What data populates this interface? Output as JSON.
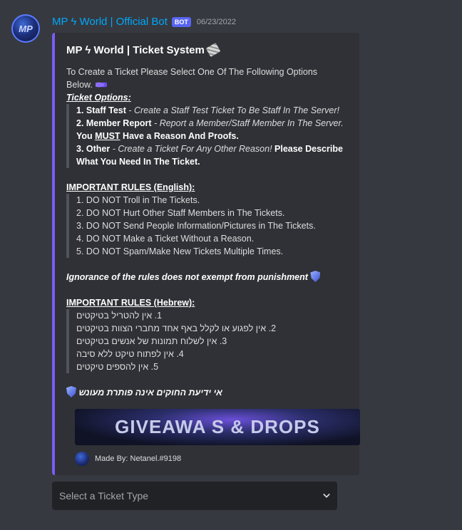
{
  "message": {
    "avatar_text": "MP",
    "username": "MP ϟ World | Official Bot",
    "badge": "BOT",
    "timestamp": "06/23/2022"
  },
  "embed": {
    "accent_color": "#7b5cf7",
    "title": "MP ϟ World | Ticket System",
    "title_icon": "ticket-icon",
    "intro_1": "To Create a Ticket Please Select One Of The Following Options",
    "intro_2": "Below.",
    "options_heading": "Ticket Options:",
    "opt1_label": "1. Staff Test",
    "opt1_desc": " - Create a Staff Test Ticket To Be Staff In The Server!",
    "opt2_label": "2. Member Report",
    "opt2_desc": " - Report a Member/Staff Member In The Server.",
    "opt2_extra_a": "You ",
    "opt2_extra_must": "MUST",
    "opt2_extra_b": " Have a Reason And Proofs.",
    "opt3_label": "3. Other",
    "opt3_desc": " - Create a Ticket For Any Other Reason!",
    "opt3_extra_a": " Please Describe",
    "opt3_extra_b": "What You Need In The Ticket.",
    "rules_en_heading": "IMPORTANT RULES (English):",
    "rules_en": [
      "1. DO NOT Troll in The Tickets.",
      "2. DO NOT Hurt Other Staff Members in The Tickets.",
      "3. DO NOT Send People Information/Pictures in The Tickets.",
      "4. DO NOT Make a Ticket Without a Reason.",
      "5. DO NOT Spam/Make New Tickets Multiple Times."
    ],
    "ignorance_en": "Ignorance of the rules does not exempt from punishment",
    "rules_he_heading": "IMPORTANT RULES (Hebrew):",
    "rules_he": [
      "1. אין להטריל בטיקטים",
      "2. אין לפגוע או לקלל באף אחד מחברי הצוות בטיקטים",
      "3. אין לשלוח תמונות של אנשים בטיקטים",
      "4. אין לפתוח טיקט ללא סיבה",
      "5. אין להספים טיקטים"
    ],
    "ignorance_he": "אי ידיעת החוקים אינה פותרת מעונש",
    "image_text": "GIVEAWA S & DROPS",
    "footer": "Made By: Netanel.#9198"
  },
  "select": {
    "placeholder": "Select a Ticket Type"
  }
}
